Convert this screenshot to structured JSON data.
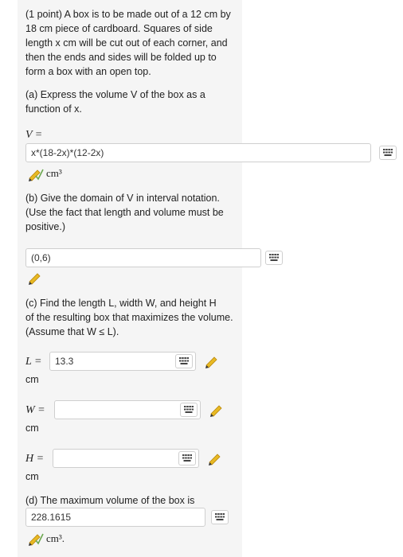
{
  "intro": {
    "lines": [
      "(1 point) A box is to be made out of a 12 cm by",
      "18 cm piece of cardboard. Squares of side",
      "length x cm will be cut out of each corner, and",
      "then the ends and sides will be folded up to",
      "form a box with an open top."
    ]
  },
  "part_a": {
    "prompt_line1": "(a) Express the volume V of the box as a",
    "prompt_line2": "function of x.",
    "lhs": "V =",
    "answer": "x*(18-2x)*(12-2x)",
    "unit": "cm³"
  },
  "part_b": {
    "line1": "(b) Give the domain of V in interval notation.",
    "line2": "(Use the fact that length and volume must be",
    "line3": "positive.)",
    "answer": "(0,6)"
  },
  "part_c": {
    "line1": "(c) Find the length L, width W, and height H",
    "line2": "of the resulting box that maximizes the volume.",
    "line3": "(Assume that W ≤ L).",
    "L_label": "L =",
    "L_value": "13.3",
    "L_unit": "cm",
    "W_label": "W =",
    "W_value": "",
    "W_unit": "cm",
    "H_label": "H =",
    "H_value": "",
    "H_unit": "cm"
  },
  "part_d": {
    "prompt": "(d) The maximum volume of the box is",
    "answer": "228.1615",
    "unit": "cm³."
  },
  "icons": {
    "keyboard": "keyboard-icon",
    "pencil": "pencil-icon"
  },
  "colors": {
    "panel": "#f5f5f5",
    "pencil_body": "#e8b923",
    "pencil_check": "#6aa84f"
  }
}
